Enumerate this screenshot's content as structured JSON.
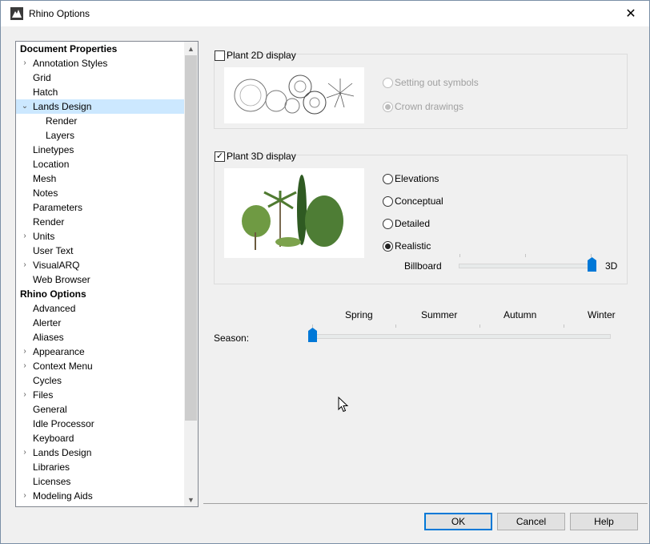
{
  "window": {
    "title": "Rhino Options"
  },
  "tree": {
    "items": [
      {
        "label": "Document Properties",
        "header": true
      },
      {
        "label": "Annotation Styles",
        "level": 1,
        "expander": "collapsed"
      },
      {
        "label": "Grid",
        "level": 1
      },
      {
        "label": "Hatch",
        "level": 1
      },
      {
        "label": "Lands Design",
        "level": 1,
        "expander": "expanded",
        "selected": true
      },
      {
        "label": "Render",
        "level": 2
      },
      {
        "label": "Layers",
        "level": 2
      },
      {
        "label": "Linetypes",
        "level": 1
      },
      {
        "label": "Location",
        "level": 1
      },
      {
        "label": "Mesh",
        "level": 1
      },
      {
        "label": "Notes",
        "level": 1
      },
      {
        "label": "Parameters",
        "level": 1
      },
      {
        "label": "Render",
        "level": 1
      },
      {
        "label": "Units",
        "level": 1,
        "expander": "collapsed"
      },
      {
        "label": "User Text",
        "level": 1
      },
      {
        "label": "VisualARQ",
        "level": 1,
        "expander": "collapsed"
      },
      {
        "label": "Web Browser",
        "level": 1
      },
      {
        "label": "Rhino Options",
        "header": true
      },
      {
        "label": "Advanced",
        "level": 1
      },
      {
        "label": "Alerter",
        "level": 1
      },
      {
        "label": "Aliases",
        "level": 1
      },
      {
        "label": "Appearance",
        "level": 1,
        "expander": "collapsed"
      },
      {
        "label": "Context Menu",
        "level": 1,
        "expander": "collapsed"
      },
      {
        "label": "Cycles",
        "level": 1
      },
      {
        "label": "Files",
        "level": 1,
        "expander": "collapsed"
      },
      {
        "label": "General",
        "level": 1
      },
      {
        "label": "Idle Processor",
        "level": 1
      },
      {
        "label": "Keyboard",
        "level": 1
      },
      {
        "label": "Lands Design",
        "level": 1,
        "expander": "collapsed"
      },
      {
        "label": "Libraries",
        "level": 1
      },
      {
        "label": "Licenses",
        "level": 1
      },
      {
        "label": "Modeling Aids",
        "level": 1,
        "expander": "collapsed"
      }
    ]
  },
  "plant2d": {
    "label": "Plant 2D display",
    "checked": false,
    "options": [
      {
        "label": "Setting out symbols",
        "checked": false
      },
      {
        "label": "Crown drawings",
        "checked": true
      }
    ]
  },
  "plant3d": {
    "label": "Plant 3D display",
    "checked": true,
    "check_mark": "✓",
    "options": [
      {
        "label": "Elevations",
        "checked": false
      },
      {
        "label": "Conceptual",
        "checked": false
      },
      {
        "label": "Detailed",
        "checked": false
      },
      {
        "label": "Realistic",
        "checked": true
      }
    ],
    "slider": {
      "left_label": "Billboard",
      "right_label": "3D",
      "value": 1.0
    }
  },
  "season": {
    "label": "Season:",
    "marks": [
      "Spring",
      "Summer",
      "Autumn",
      "Winter"
    ],
    "value": 0.0
  },
  "buttons": {
    "ok": "OK",
    "cancel": "Cancel",
    "help": "Help"
  },
  "icons": {
    "close": "✕",
    "expand_collapsed": "›",
    "expand_expanded": "⌄",
    "scroll_up": "▲",
    "scroll_down": "▼"
  },
  "colors": {
    "selection": "#cce8ff",
    "accent": "#0078d7"
  }
}
